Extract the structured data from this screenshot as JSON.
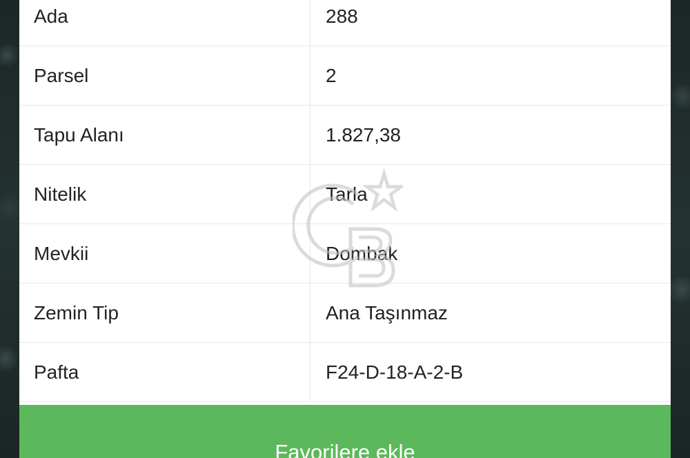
{
  "details": {
    "rows": [
      {
        "label": "Ada",
        "value": "288"
      },
      {
        "label": "Parsel",
        "value": "2"
      },
      {
        "label": "Tapu Alanı",
        "value": "1.827,38"
      },
      {
        "label": "Nitelik",
        "value": "Tarla"
      },
      {
        "label": "Mevkii",
        "value": "Dombak"
      },
      {
        "label": "Zemin Tip",
        "value": "Ana Taşınmaz"
      },
      {
        "label": "Pafta",
        "value": "F24-D-18-A-2-B"
      }
    ]
  },
  "actions": {
    "favorite_label": "Favorilere ekle"
  },
  "colors": {
    "button_green": "#5cb85c",
    "panel_bg": "#ffffff",
    "text": "#222222"
  }
}
